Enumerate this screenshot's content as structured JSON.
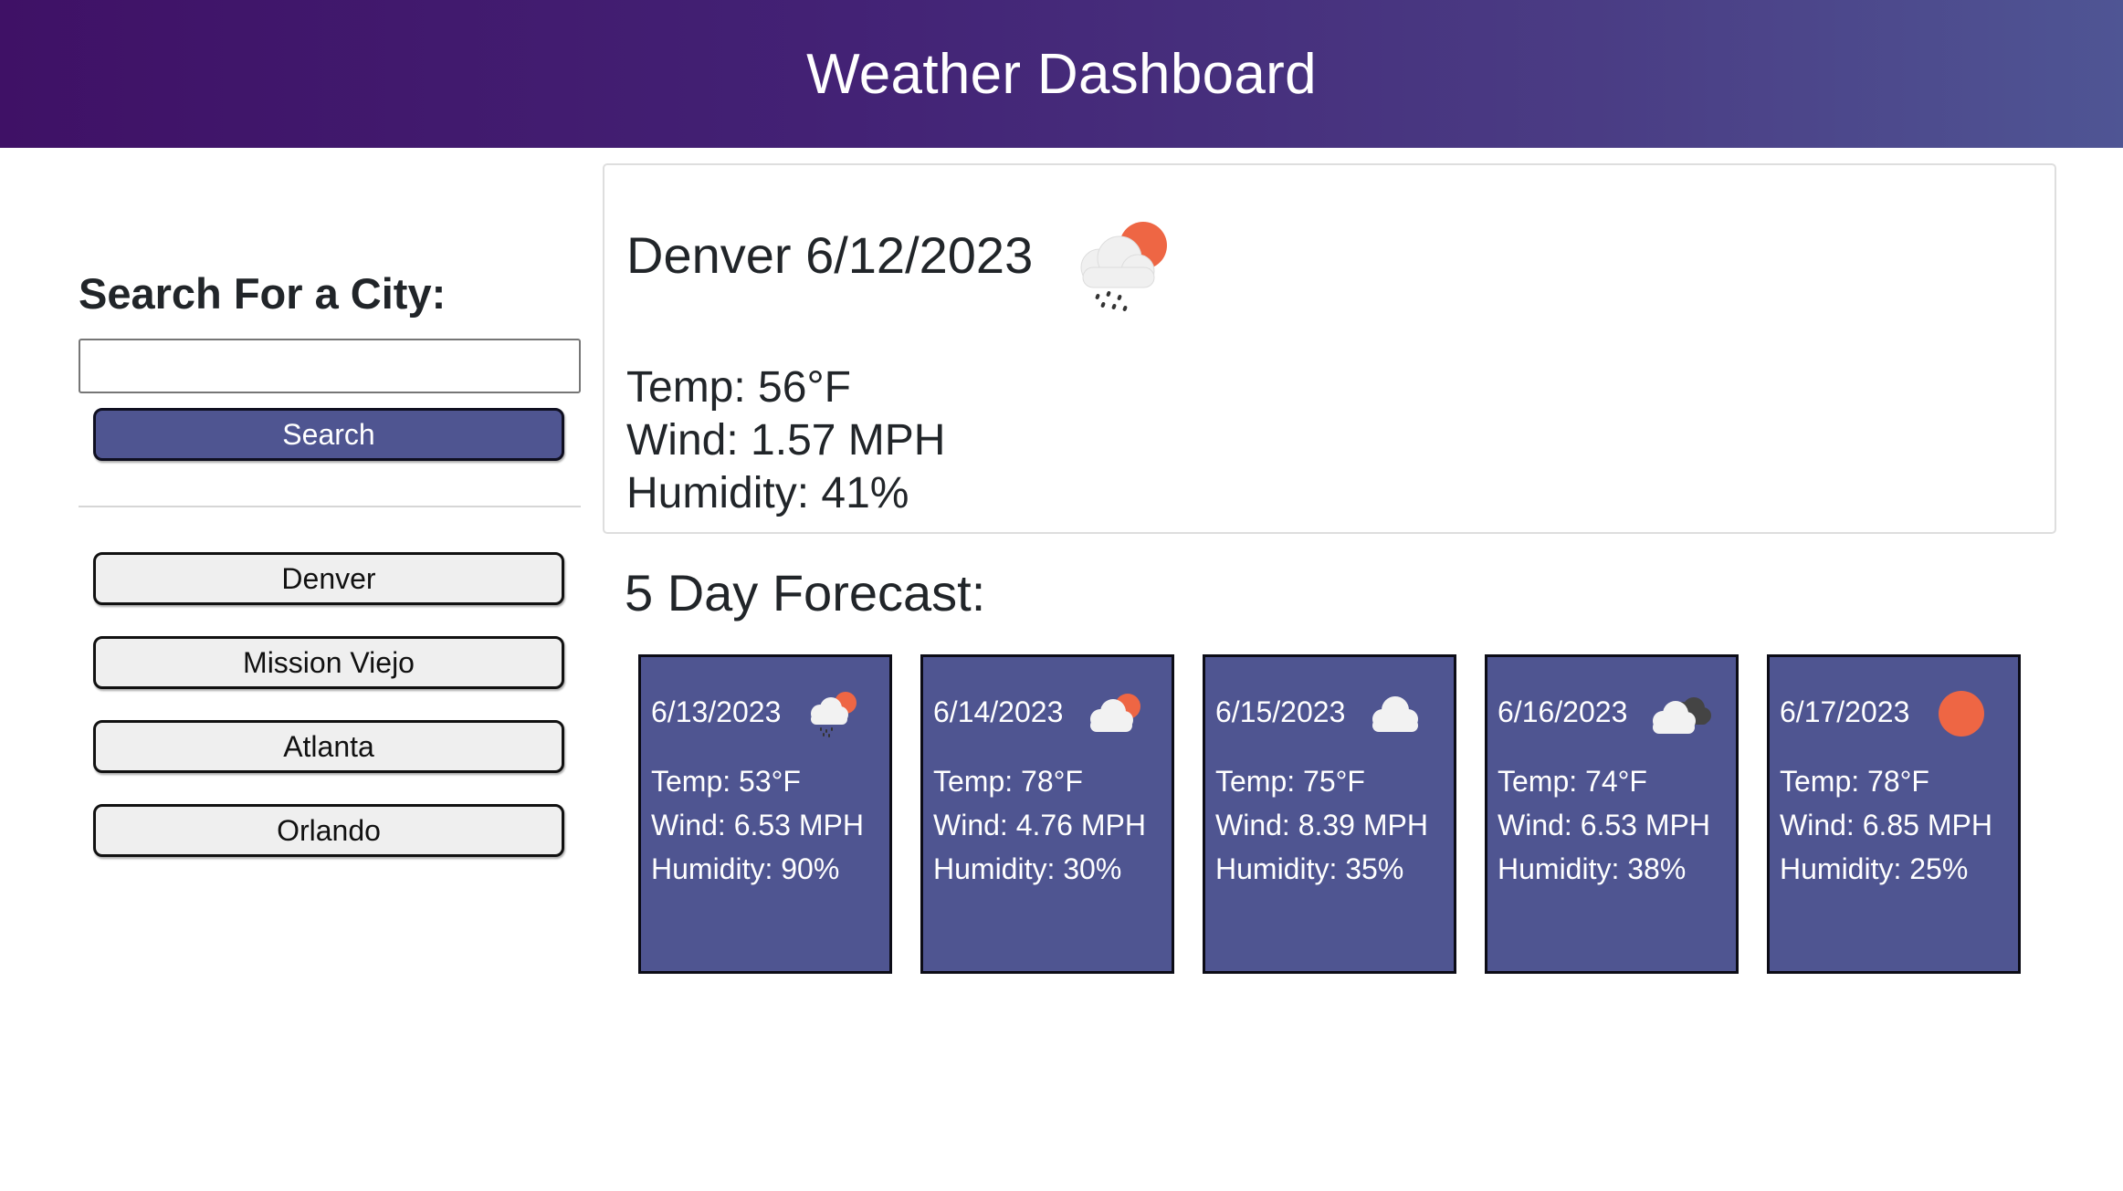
{
  "header": {
    "title": "Weather Dashboard",
    "background_from": "#3f1166",
    "background_to": "#4f5594"
  },
  "sidebar": {
    "search_heading": "Search For a City:",
    "search_input_value": "",
    "search_button_label": "Search",
    "history": [
      {
        "label": "Denver"
      },
      {
        "label": "Mission Viejo"
      },
      {
        "label": "Atlanta"
      },
      {
        "label": "Orlando"
      }
    ]
  },
  "current": {
    "title": "Denver 6/12/2023",
    "icon": "rain-cloud-sun-icon",
    "temp": "Temp: 56°F",
    "wind": "Wind: 1.57 MPH",
    "humidity": "Humidity: 41%"
  },
  "forecast": {
    "heading": "5 Day Forecast:",
    "card_color": "#4f5591",
    "days": [
      {
        "date": "6/13/2023",
        "icon": "rain-cloud-sun-icon",
        "temp": "Temp: 53°F",
        "wind": "Wind: 6.53 MPH",
        "humidity": "Humidity: 90%"
      },
      {
        "date": "6/14/2023",
        "icon": "cloud-sun-icon",
        "temp": "Temp: 78°F",
        "wind": "Wind: 4.76 MPH",
        "humidity": "Humidity: 30%"
      },
      {
        "date": "6/15/2023",
        "icon": "cloud-icon",
        "temp": "Temp: 75°F",
        "wind": "Wind: 8.39 MPH",
        "humidity": "Humidity: 35%"
      },
      {
        "date": "6/16/2023",
        "icon": "broken-clouds-icon",
        "temp": "Temp: 74°F",
        "wind": "Wind: 6.53 MPH",
        "humidity": "Humidity: 38%"
      },
      {
        "date": "6/17/2023",
        "icon": "sun-icon",
        "temp": "Temp: 78°F",
        "wind": "Wind: 6.85 MPH",
        "humidity": "Humidity: 25%"
      }
    ]
  },
  "colors": {
    "sun": "#ee6644",
    "cloud_light": "#f2f2f2",
    "cloud_dark": "#444444"
  }
}
